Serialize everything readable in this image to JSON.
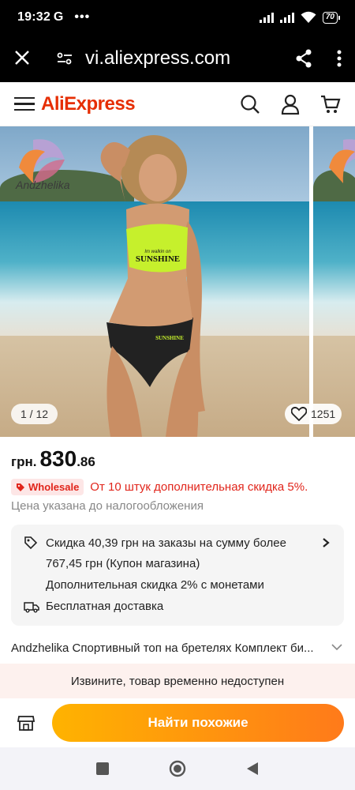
{
  "status_bar": {
    "time": "19:32",
    "g_label": "G",
    "dots": "•••",
    "battery": "70"
  },
  "browser": {
    "url": "vi.aliexpress.com"
  },
  "header": {
    "logo": "AliExpress"
  },
  "gallery": {
    "counter": "1 / 12",
    "likes": "1251",
    "brand_text": "Andzhelika",
    "top_text": "Im walkin on",
    "top_print": "SUNSHINE",
    "bottom_print": "SUNSHINE"
  },
  "price": {
    "currency": "грн.",
    "integer": "830",
    "decimal": ".86"
  },
  "wholesale": {
    "badge": "Wholesale",
    "text": "От 10 штук дополнительная скидка 5%."
  },
  "tax_note": "Цена указана до налогообложения",
  "coupons": {
    "coupon_line1": "Скидка 40,39 грн на заказы на сумму более",
    "coupon_line2": "767,45 грн (Купон магазина)",
    "coins": "Дополнительная скидка 2% с монетами",
    "shipping": "Бесплатная доставка"
  },
  "product_title": "Andzhelika Спортивный топ на бретелях Комплект би...",
  "unavailable_text": "Извините, товар временно недоступен",
  "actions": {
    "find_similar": "Найти похожие"
  },
  "colors": {
    "brand": "#e62e04",
    "accent_red": "#e1251b",
    "button_start": "#ffb300",
    "button_end": "#ff7a1a",
    "swimsuit_top": "#c6f02c"
  }
}
